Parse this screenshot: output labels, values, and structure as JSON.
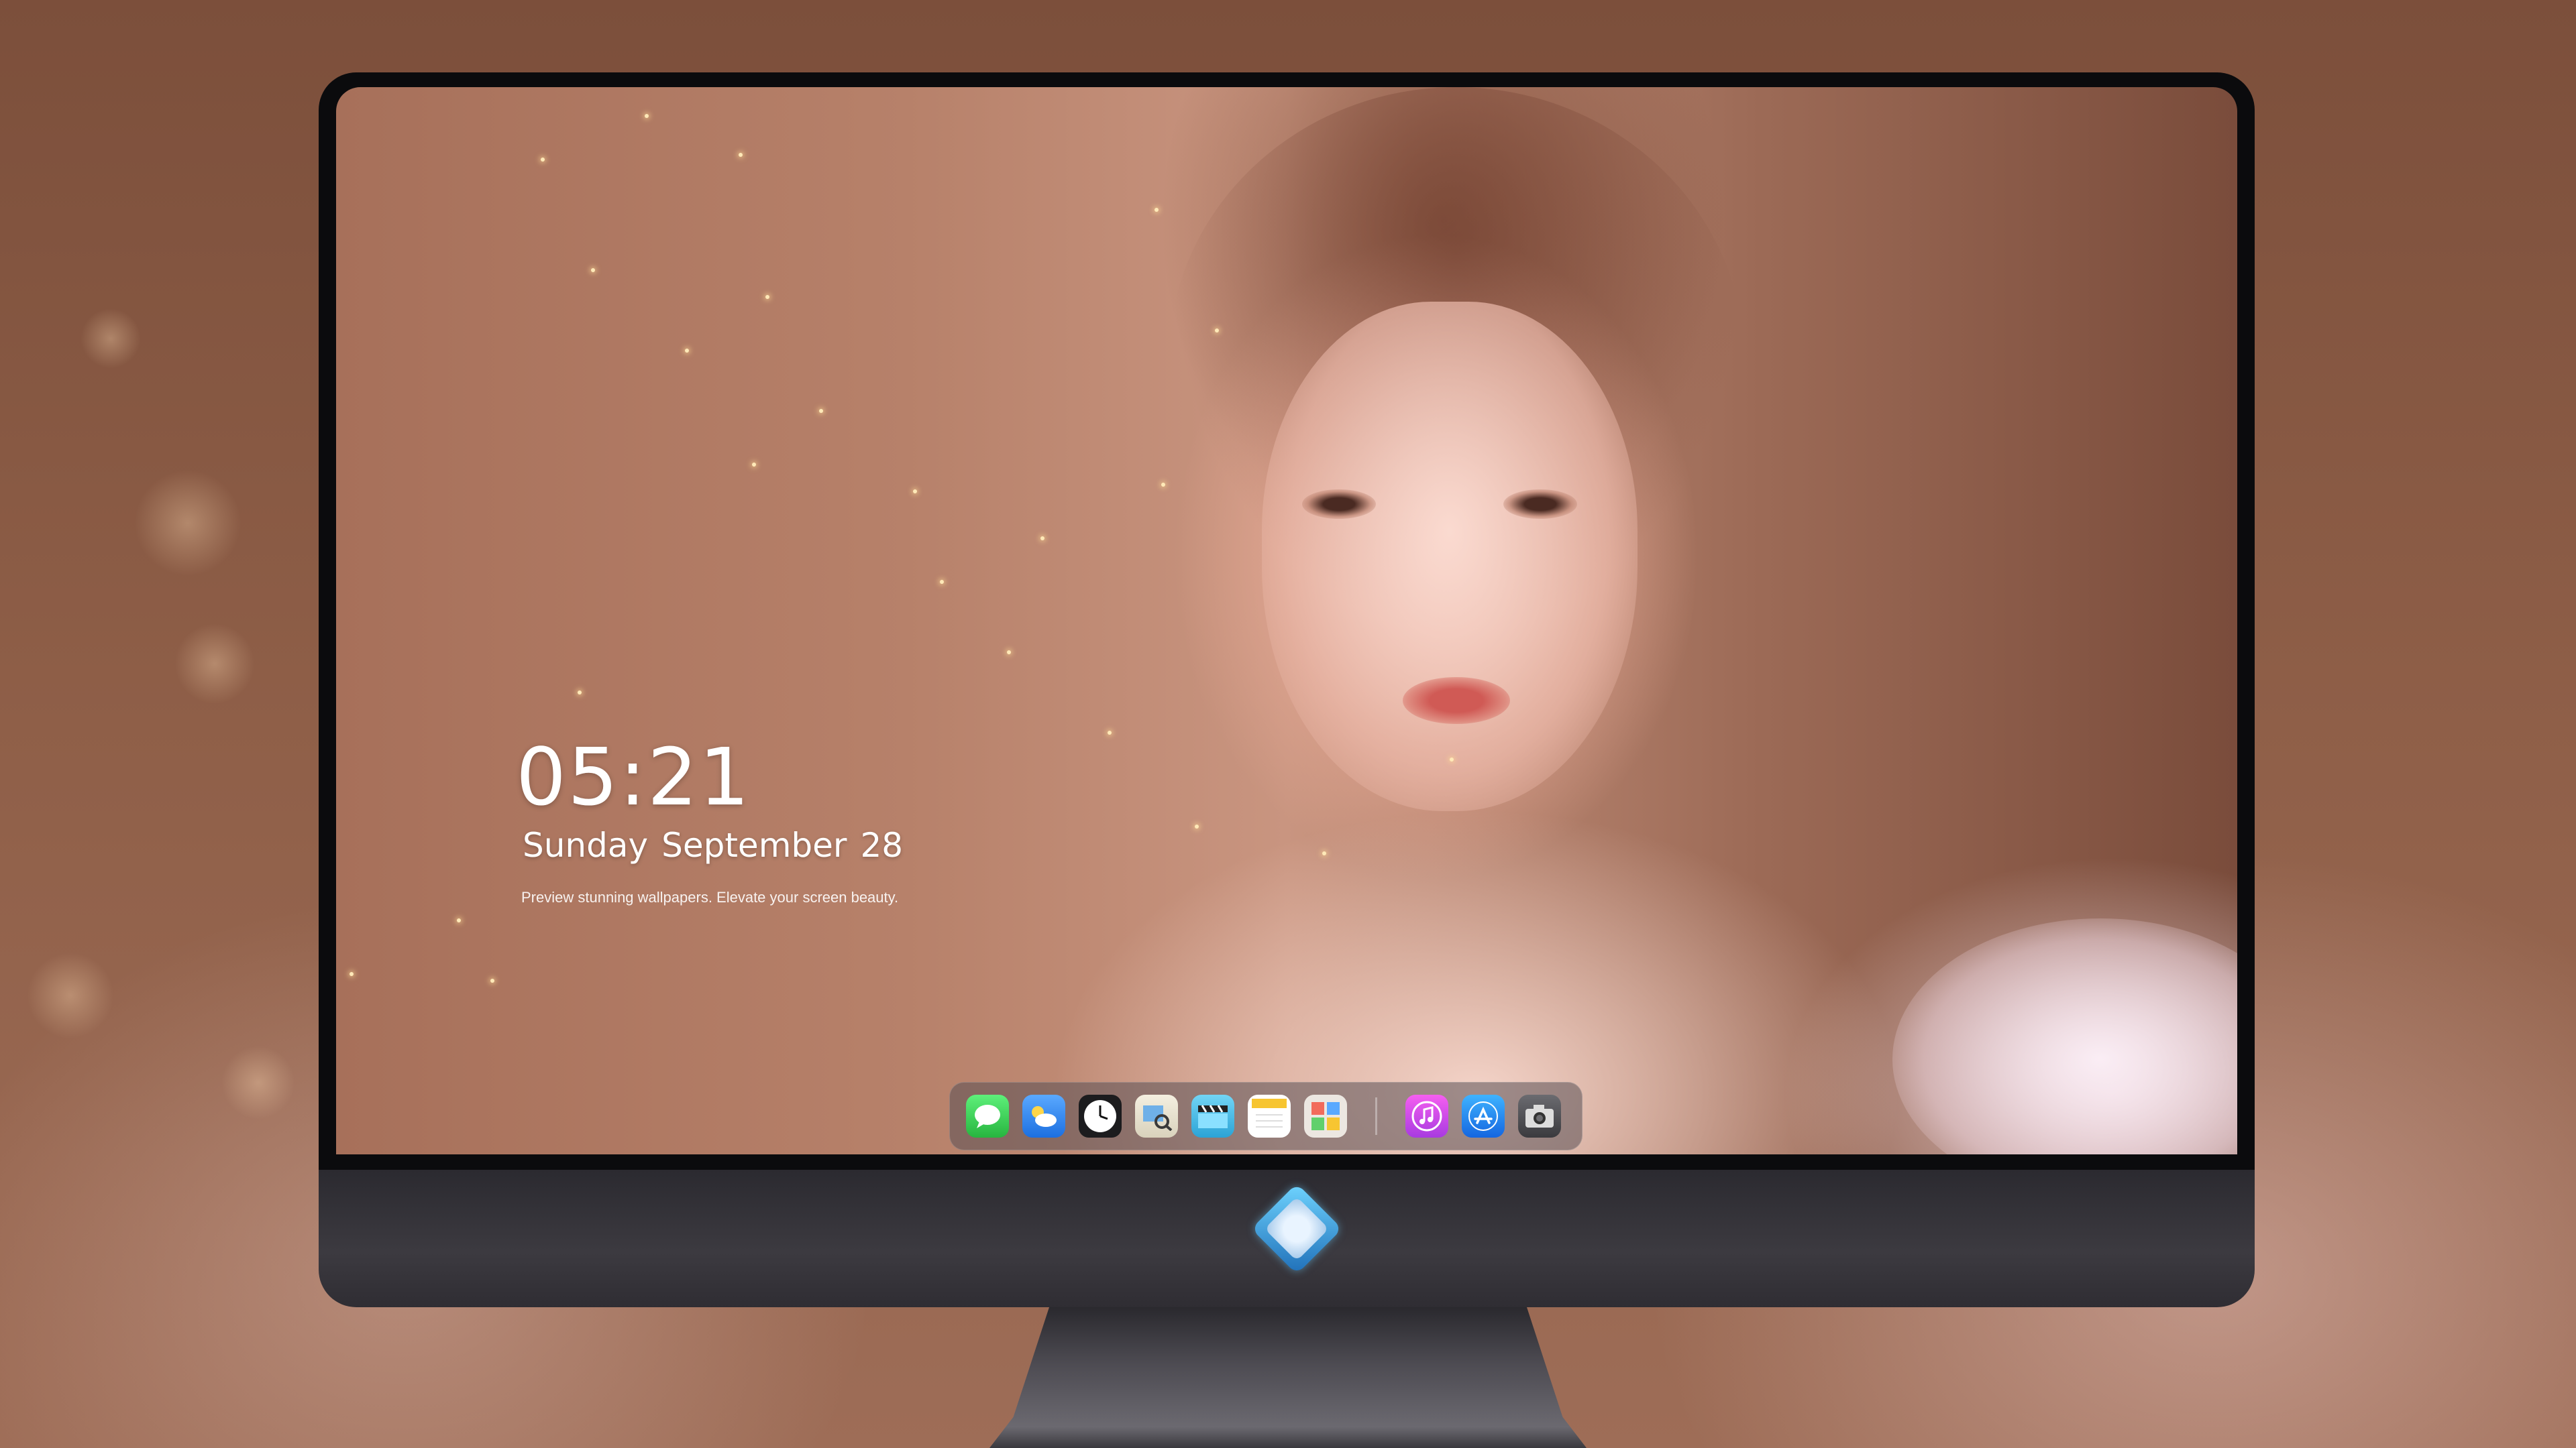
{
  "lock_screen": {
    "time": "05:21",
    "weekday": "Sunday",
    "month": "September",
    "day": "28",
    "tagline": "Preview stunning wallpapers. Elevate your screen beauty."
  },
  "dock": {
    "apps": [
      {
        "name": "messages-icon",
        "color": "#3fd358"
      },
      {
        "name": "weather-icon",
        "color": "#3a8ff0"
      },
      {
        "name": "clock-icon",
        "color": "#1c1c1e"
      },
      {
        "name": "preview-icon",
        "color": "#e9e4d4"
      },
      {
        "name": "video-editor-icon",
        "color": "#4fc0e8"
      },
      {
        "name": "notes-icon",
        "color": "#f7d44a"
      },
      {
        "name": "photo-booth-icon",
        "color": "#e7e2dc"
      }
    ],
    "pinned": [
      {
        "name": "itunes-music-icon",
        "color": "#d04cf0"
      },
      {
        "name": "app-store-icon",
        "color": "#1e8fff"
      },
      {
        "name": "camera-icon",
        "color": "#4a4a4e"
      }
    ]
  },
  "chin": {
    "logo_icon": "diamond-mascot-logo-icon",
    "accent": "#6fd4ff"
  }
}
